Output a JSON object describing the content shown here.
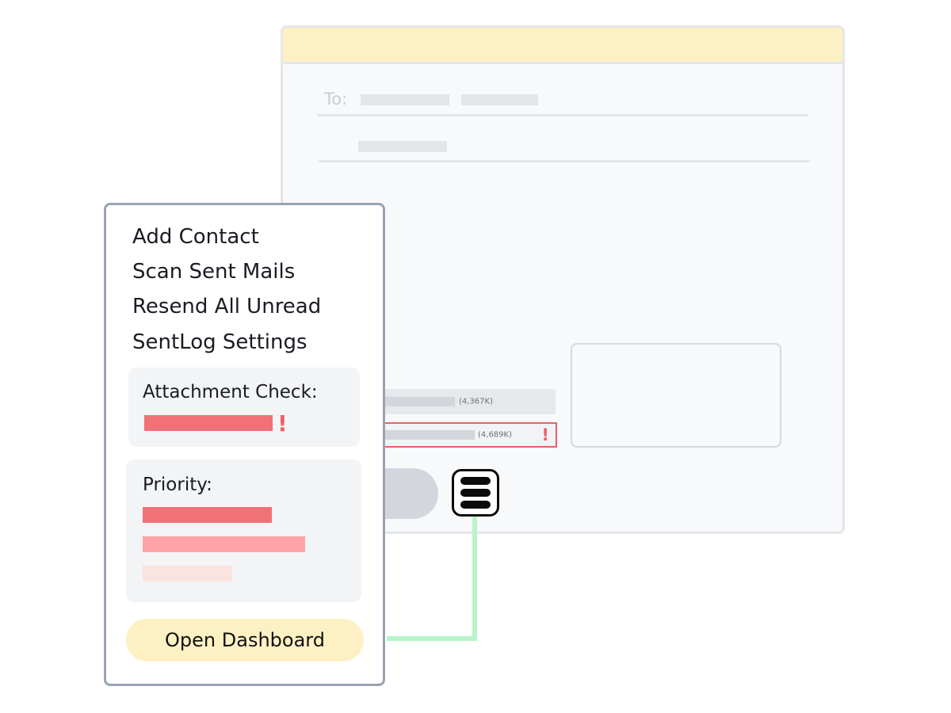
{
  "compose": {
    "to_label": "To:",
    "attachments": [
      {
        "size": "(4,367K)",
        "warning": false
      },
      {
        "size": "(4,689K)",
        "warning": true,
        "warning_icon": "!"
      }
    ]
  },
  "menu_icon": "hamburger-menu-icon",
  "panel": {
    "menu_items": [
      {
        "label": "Add Contact"
      },
      {
        "label": "Scan Sent Mails"
      },
      {
        "label": "Resend All Unread"
      },
      {
        "label": "SentLog Settings"
      }
    ],
    "attachment_check": {
      "title": "Attachment Check:",
      "alert_icon": "!"
    },
    "priority": {
      "title": "Priority:"
    },
    "dashboard_button": "Open Dashboard"
  },
  "colors": {
    "accent_yellow": "#fdf1c4",
    "alert_red": "#ef5f69",
    "priority_high": "#f07177",
    "priority_medium": "#fca4a6",
    "priority_low": "#fbe3e0",
    "connector_green": "#b9f3c9",
    "panel_border": "#98a3b5"
  }
}
